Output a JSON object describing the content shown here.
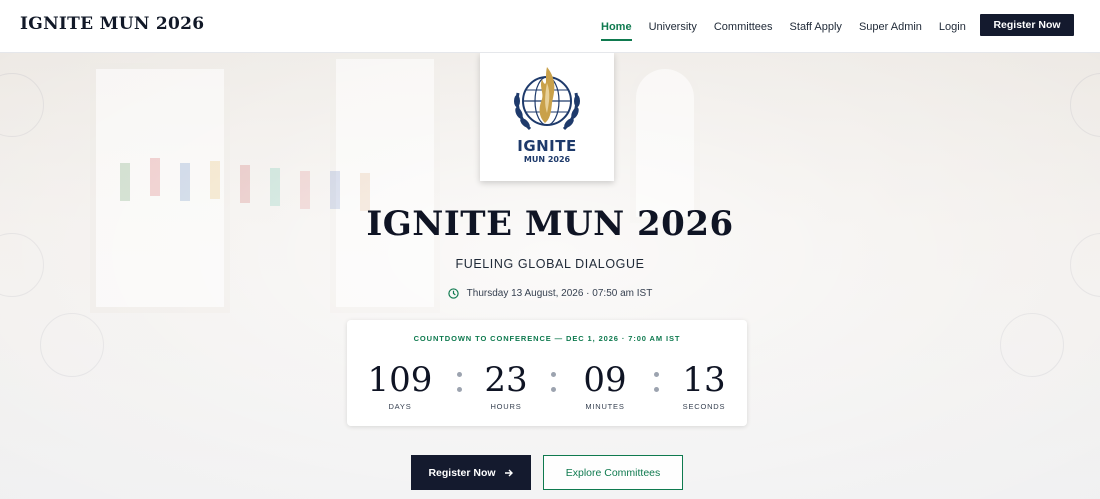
{
  "header": {
    "brand": "IGNITE MUN 2026",
    "nav": [
      {
        "label": "Home",
        "active": true
      },
      {
        "label": "University",
        "active": false
      },
      {
        "label": "Committees",
        "active": false
      },
      {
        "label": "Staff Apply",
        "active": false
      },
      {
        "label": "Super Admin",
        "active": false
      },
      {
        "label": "Login",
        "active": false
      }
    ],
    "register_label": "Register Now"
  },
  "logo": {
    "line1": "IGNITE",
    "line2": "MUN 2026",
    "icon": "un-emblem-flame-icon"
  },
  "hero": {
    "title": "IGNITE MUN 2026",
    "subtitle": "FUELING GLOBAL DIALOGUE",
    "datetime": "Thursday 13 August, 2026 · 07:50 am IST",
    "clock_icon": "clock-icon"
  },
  "countdown": {
    "label": "COUNTDOWN TO CONFERENCE — DEC 1, 2026 · 7:00 AM IST",
    "units": [
      {
        "value": "109",
        "caption": "DAYS"
      },
      {
        "value": "23",
        "caption": "HOURS"
      },
      {
        "value": "09",
        "caption": "MINUTES"
      },
      {
        "value": "13",
        "caption": "SECONDS"
      }
    ]
  },
  "actions": {
    "primary": "Register Now",
    "primary_icon": "arrow-right-icon",
    "secondary": "Explore Committees"
  },
  "colors": {
    "accent": "#0f7a4f",
    "navy": "#141a2e",
    "logo_blue": "#1e3a6b",
    "logo_gold": "#c9a14a"
  }
}
